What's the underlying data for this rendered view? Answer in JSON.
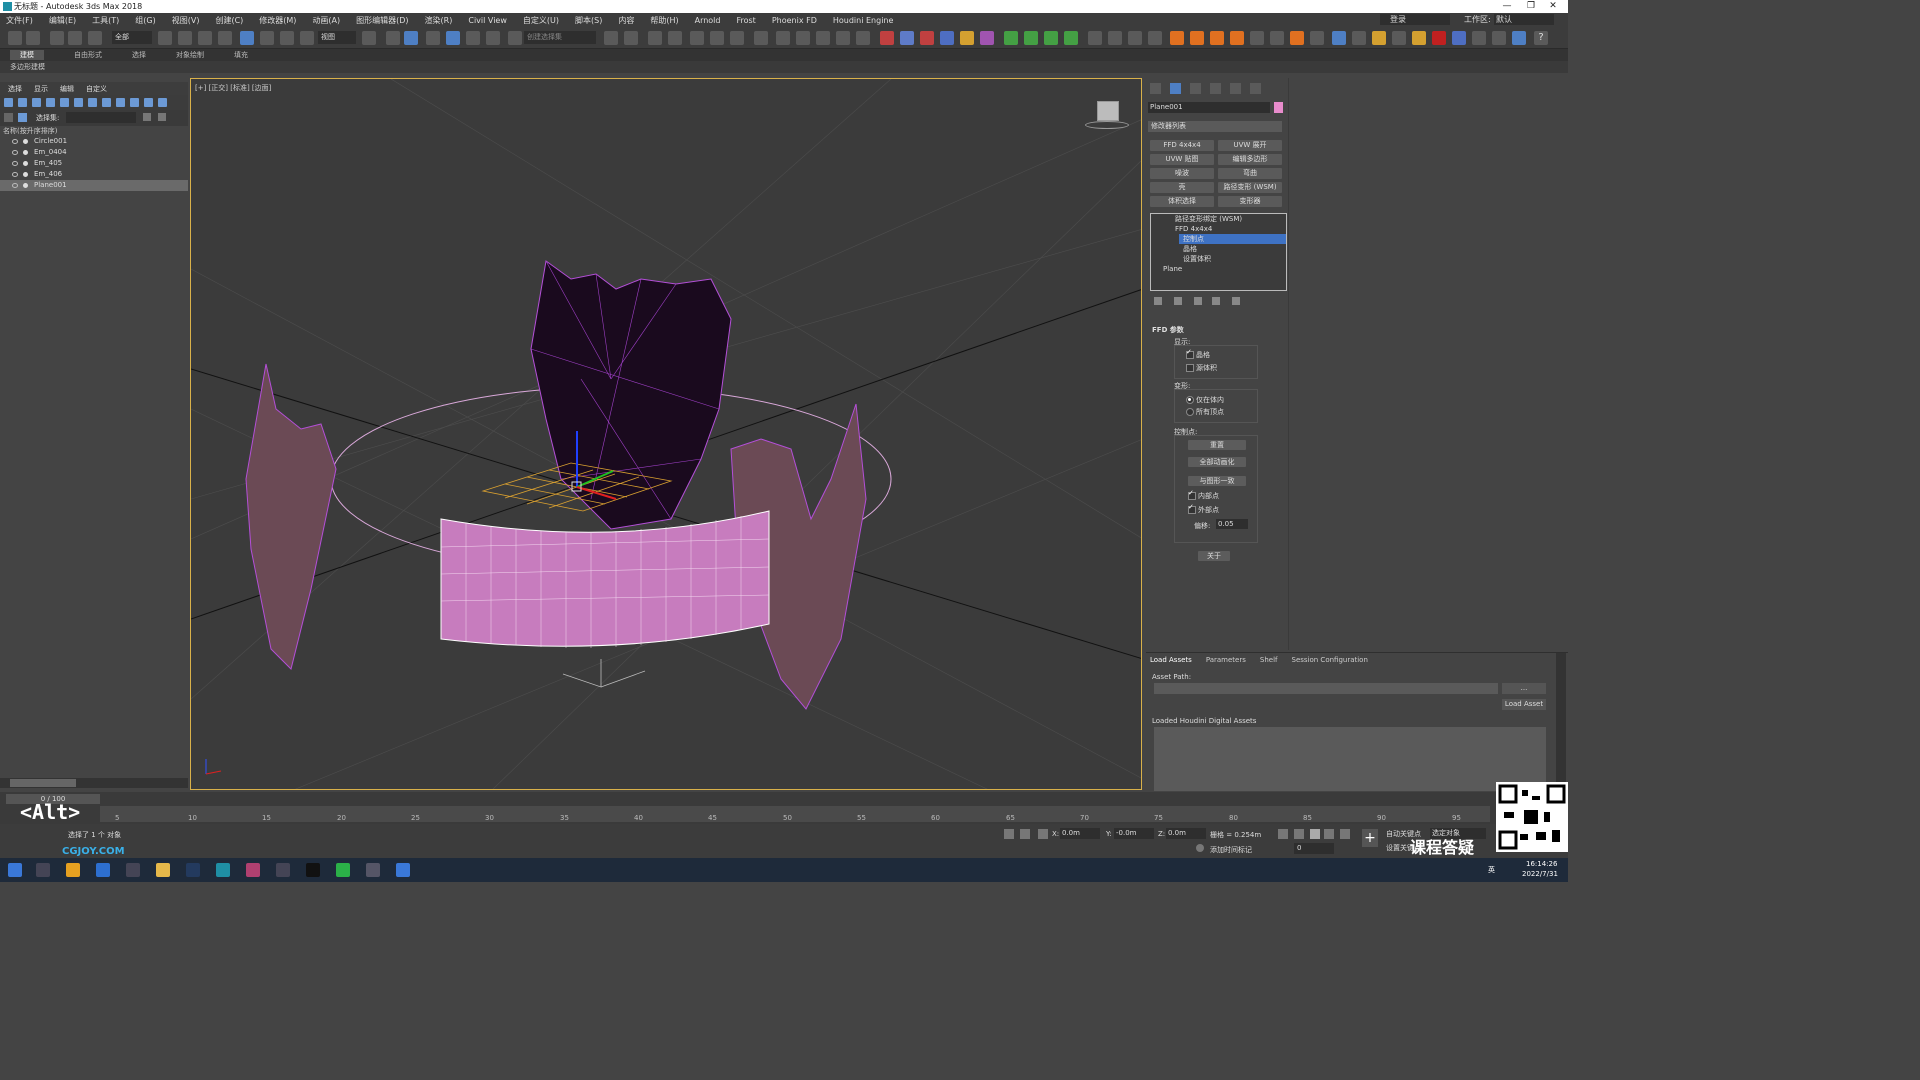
{
  "window": {
    "title": "无标题 - Autodesk 3ds Max 2018",
    "minimize": "—",
    "maximize": "❐",
    "close": "✕"
  },
  "menubar": [
    "文件(F)",
    "编辑(E)",
    "工具(T)",
    "组(G)",
    "视图(V)",
    "创建(C)",
    "修改器(M)",
    "动画(A)",
    "图形编辑器(D)",
    "渲染(R)",
    "Civil View",
    "自定义(U)",
    "脚本(S)",
    "内容",
    "帮助(H)",
    "Arnold",
    "Frost",
    "Phoenix FD",
    "Houdini Engine"
  ],
  "menubar_right": {
    "user": "登录",
    "workspace_label": "工作区:",
    "workspace_value": "默认"
  },
  "toolbar": {
    "filter_dropdown": "全部",
    "view_dropdown": "视图",
    "selection_set": "创建选择集"
  },
  "ribbon": {
    "tabs": [
      "建模",
      "自由形式",
      "选择",
      "对象绘制",
      "填充"
    ],
    "active": "建模",
    "sub": "多边形建模"
  },
  "scene_explorer": {
    "menu": [
      "选择",
      "显示",
      "编辑",
      "自定义"
    ],
    "selection_set_label": "选择集:",
    "column_header": "名称(按升序排序)",
    "objects": [
      {
        "name": "Circle001",
        "selected": false
      },
      {
        "name": "Em_0404",
        "selected": false
      },
      {
        "name": "Em_405",
        "selected": false
      },
      {
        "name": "Em_406",
        "selected": false
      },
      {
        "name": "Plane001",
        "selected": true
      }
    ]
  },
  "viewport": {
    "label": "[+] [正交] [标准] [边面]"
  },
  "command_panel": {
    "object_name": "Plane001",
    "object_color": "#e88ccc",
    "modifier_list": "修改器列表",
    "modifier_buttons": [
      [
        "FFD 4x4x4",
        "UVW 展开"
      ],
      [
        "UVW 贴图",
        "编辑多边形"
      ],
      [
        "噪波",
        "弯曲"
      ],
      [
        "壳",
        "路径变形 (WSM)"
      ],
      [
        "体积选择",
        "变形器"
      ]
    ],
    "stack": {
      "items": [
        "路径变形绑定 (WSM)",
        "FFD 4x4x4",
        "控制点",
        "晶格",
        "设置体积",
        "Plane"
      ],
      "selected": "控制点"
    },
    "ffd": {
      "title": "FFD 参数",
      "display_label": "显示:",
      "display_options": [
        {
          "label": "晶格",
          "checked": true
        },
        {
          "label": "源体积",
          "checked": false
        }
      ],
      "deform_label": "变形:",
      "deform_options": [
        {
          "label": "仅在体内",
          "checked": true
        },
        {
          "label": "所有顶点",
          "checked": false
        }
      ],
      "control_points_label": "控制点:",
      "buttons": [
        "重置",
        "全部动画化",
        "与图形一致"
      ],
      "checks": [
        {
          "label": "内部点",
          "checked": true
        },
        {
          "label": "外部点",
          "checked": true
        }
      ],
      "offset_label": "偏移:",
      "offset_value": "0.05",
      "about": "关于"
    }
  },
  "houdini": {
    "tabs": [
      "Load Assets",
      "Parameters",
      "Shelf",
      "Session Configuration"
    ],
    "active_tab": "Load Assets",
    "asset_path_label": "Asset Path:",
    "browse": "...",
    "load_button": "Load Asset",
    "loaded_label": "Loaded Houdini Digital Assets"
  },
  "timeline": {
    "frame_display": "0 / 100",
    "ticks": [
      "5",
      "10",
      "15",
      "20",
      "25",
      "30",
      "35",
      "40",
      "45",
      "50",
      "55",
      "60",
      "65",
      "70",
      "75",
      "80",
      "85",
      "90",
      "95"
    ]
  },
  "status": {
    "selection": "选择了 1 个 对象",
    "x_label": "X:",
    "x_value": "0.0m",
    "y_label": "Y:",
    "y_value": "-0.0m",
    "z_label": "Z:",
    "z_value": "0.0m",
    "grid": "栅格 = 0.254m",
    "add_time_tag": "添加时间标记",
    "auto_key": "自动关键点",
    "set_key": "设置关键点",
    "selected_obj": "选定对象",
    "frame": "0"
  },
  "overlay": {
    "alt_key": "<Alt>",
    "watermark": "课程答疑",
    "logo_text": "CGJOY.COM"
  },
  "taskbar": {
    "time": "16:14:26",
    "date": "2022/7/31",
    "lang": "英"
  }
}
